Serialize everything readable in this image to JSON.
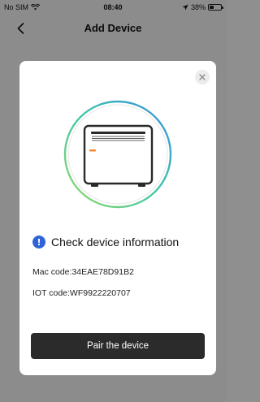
{
  "status_bar": {
    "carrier": "No SIM",
    "time": "08:40",
    "battery_percent": "38%",
    "battery_level": 0.38
  },
  "nav": {
    "title": "Add Device",
    "back_icon": "chevron-left-icon"
  },
  "modal": {
    "close_icon": "close-icon",
    "illustration_icon": "air-conditioner-icon",
    "ring_gradient": [
      "#9bd86a",
      "#3ec9a7",
      "#3a8de3"
    ],
    "check_title": "Check device information",
    "mac_line": "Mac code:34EAE78D91B2",
    "iot_line": "IOT code:WF9922220707",
    "pair_button": "Pair the device",
    "accent_info_color": "#2f64d8",
    "button_color": "#2b2b2b"
  }
}
